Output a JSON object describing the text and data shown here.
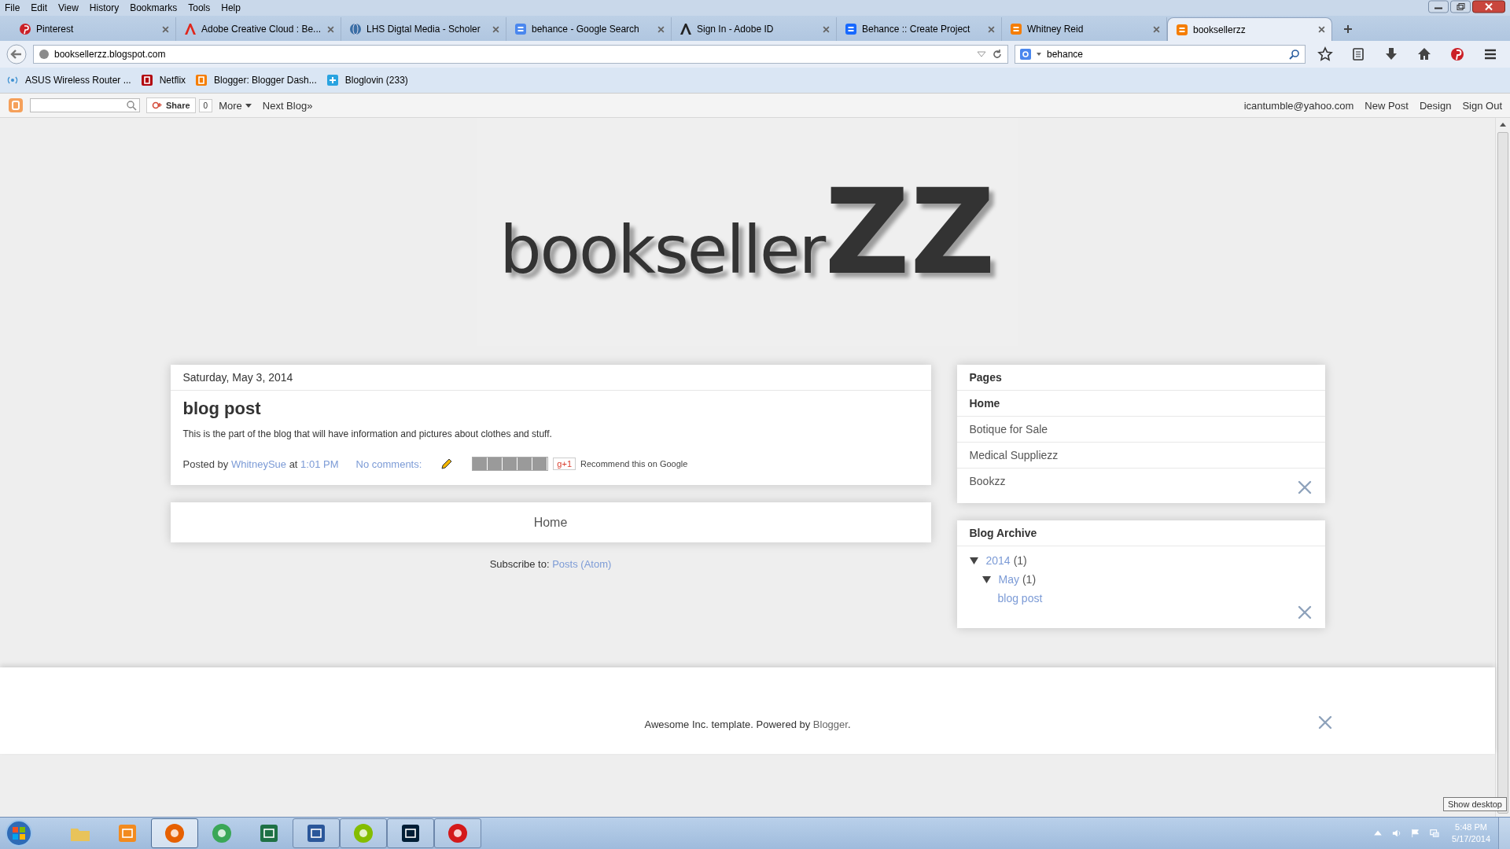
{
  "menu_bar": [
    "File",
    "Edit",
    "View",
    "History",
    "Bookmarks",
    "Tools",
    "Help"
  ],
  "tabs": [
    {
      "title": "Pinterest",
      "kind": "pinterest",
      "selected": false
    },
    {
      "title": "Adobe Creative Cloud : Be...",
      "kind": "adobe",
      "selected": false
    },
    {
      "title": "LHS Digtal Media - Scholer",
      "kind": "globe",
      "selected": false
    },
    {
      "title": "behance - Google Search",
      "kind": "google",
      "selected": false
    },
    {
      "title": "Sign In - Adobe ID",
      "kind": "adobe-id",
      "selected": false
    },
    {
      "title": "Behance :: Create Project",
      "kind": "behance",
      "selected": false
    },
    {
      "title": "Whitney Reid",
      "kind": "blogger",
      "selected": false
    },
    {
      "title": "booksellerzz",
      "kind": "blogger",
      "selected": true
    }
  ],
  "address_bar": {
    "url": "booksellerzz.blogspot.com"
  },
  "search_bar": {
    "value": "behance"
  },
  "bookmarks": [
    {
      "label": "ASUS Wireless Router ...",
      "kind": "wireless"
    },
    {
      "label": "Netflix",
      "kind": "netflix"
    },
    {
      "label": "Blogger: Blogger Dash...",
      "kind": "blogger"
    },
    {
      "label": "Bloglovin (233)",
      "kind": "plus"
    }
  ],
  "blogger_bar": {
    "share": "Share",
    "share_count": "0",
    "more": "More",
    "next_blog": "Next Blog»",
    "email": "icantumble@yahoo.com",
    "links": [
      "New Post",
      "Design",
      "Sign Out"
    ]
  },
  "header": {
    "title": "bookseller",
    "title_accent": "ZZ"
  },
  "post": {
    "date": "Saturday, May 3, 2014",
    "title": "blog post",
    "body": "This is the part of the blog that will have information and pictures about clothes and stuff.",
    "posted_by": "Posted by",
    "author": "WhitneySue",
    "at": "at",
    "time": "1:01 PM",
    "comments": "No comments:",
    "plus_one": "g+1",
    "recommend": "Recommend this on Google"
  },
  "pager": {
    "home": "Home"
  },
  "subscribe": {
    "label": "Subscribe to:",
    "link": "Posts (Atom)"
  },
  "sidebar": {
    "pages": {
      "title": "Pages",
      "items": [
        {
          "label": "Home",
          "selected": true
        },
        {
          "label": "Botique for Sale",
          "selected": false
        },
        {
          "label": "Medical Suppliezz",
          "selected": false
        },
        {
          "label": "Bookzz",
          "selected": false
        }
      ]
    },
    "archive": {
      "title": "Blog Archive",
      "items": [
        {
          "label": "2014",
          "count": "(1)",
          "expanded": true,
          "children": [
            {
              "label": "May",
              "count": "(1)",
              "expanded": true,
              "children": [
                {
                  "label": "blog post"
                }
              ]
            }
          ]
        }
      ]
    }
  },
  "footer": {
    "text": "Awesome Inc. template. Powered by",
    "link": "Blogger",
    "end": "."
  },
  "taskbar": {
    "apps": [
      {
        "kind": "explorer",
        "running": false,
        "selected": false
      },
      {
        "kind": "media",
        "running": false,
        "selected": false
      },
      {
        "kind": "firefox",
        "running": true,
        "selected": true
      },
      {
        "kind": "chrome",
        "running": false,
        "selected": false
      },
      {
        "kind": "excel",
        "running": false,
        "selected": false
      },
      {
        "kind": "word",
        "running": true,
        "selected": false
      },
      {
        "kind": "spotify",
        "running": true,
        "selected": false
      },
      {
        "kind": "photoshop",
        "running": true,
        "selected": false
      },
      {
        "kind": "creative-cloud",
        "running": true,
        "selected": false
      }
    ],
    "time": "5:48 PM",
    "date": "5/17/2014",
    "tooltip": "Show desktop"
  }
}
